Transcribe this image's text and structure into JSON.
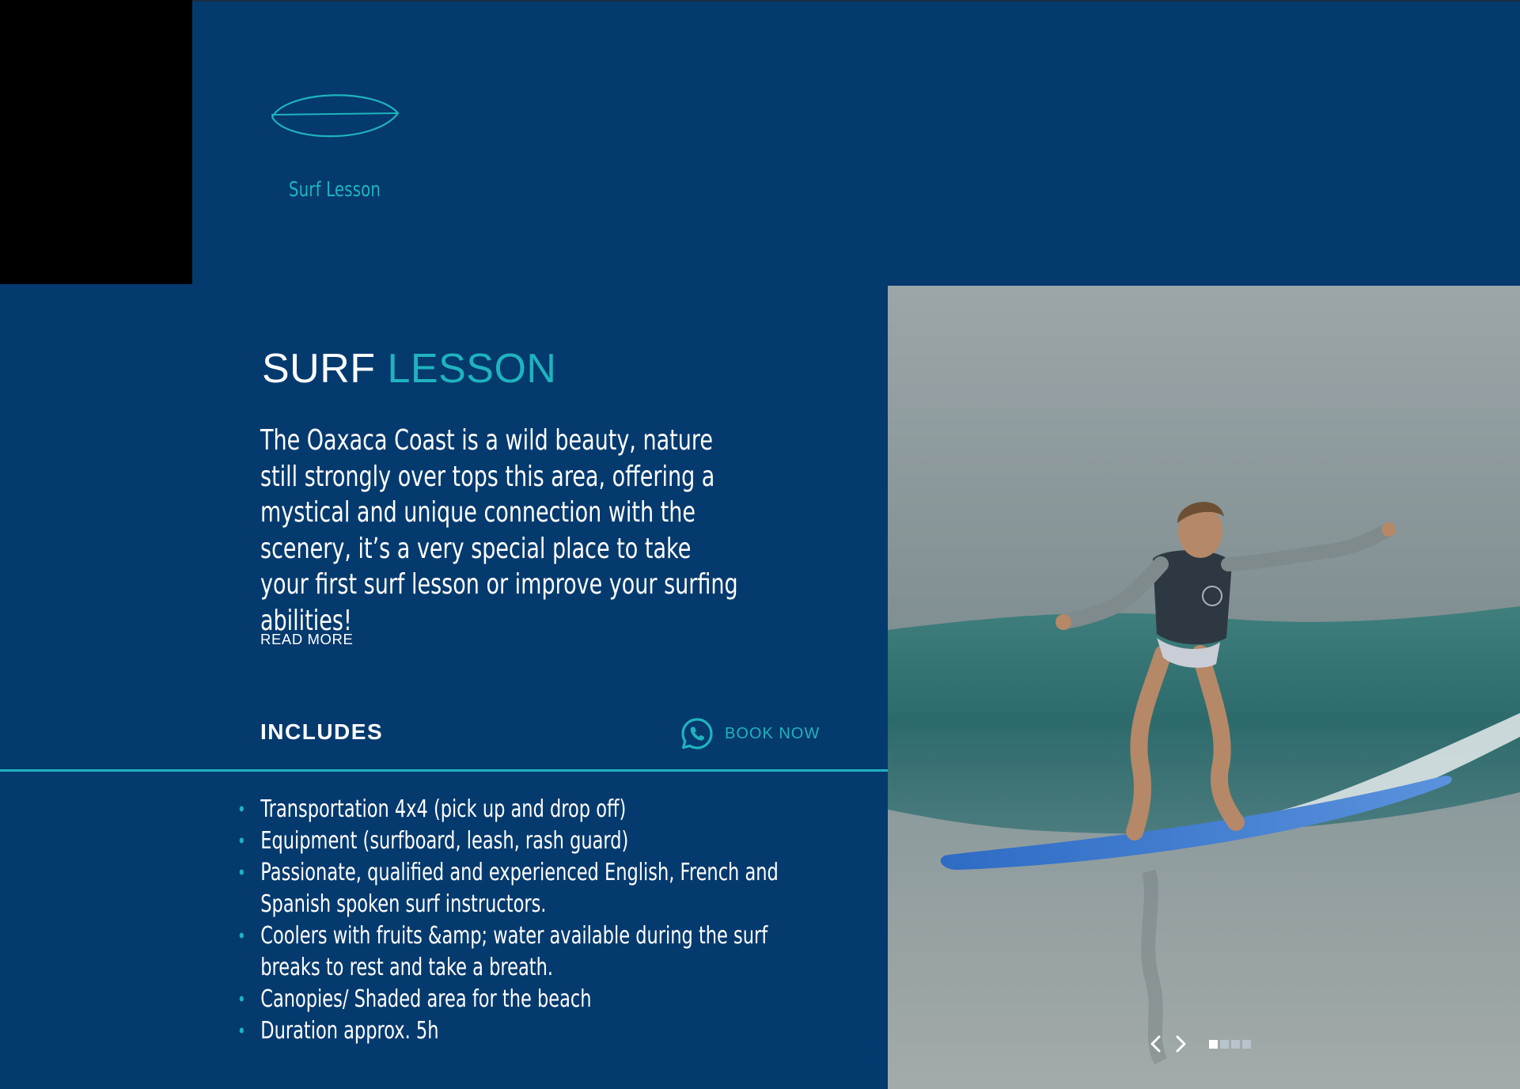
{
  "nav": {
    "surf_lesson_label": "Surf Lesson",
    "icon": "surfboard-icon"
  },
  "section": {
    "title_part1": "SURF",
    "title_part2": "LESSON",
    "description": "The Oaxaca Coast is a wild beauty, nature still strongly over tops this area, offering a mystical and unique connection with the scenery, it’s a very special place to take your first surf lesson or improve your surfing abilities!",
    "read_more": "READ MORE",
    "includes_title": "INCLUDES",
    "book_now": "BOOK NOW",
    "book_icon": "whatsapp-icon",
    "includes": [
      "Transportation 4x4 (pick up and drop off)",
      "Equipment (surfboard, leash, rash guard)",
      "Passionate, qualified and experienced English, French and Spanish spoken surf instructors.",
      "Coolers with fruits &amp; water available during the surf breaks to rest and take a breath.",
      "Canopies/ Shaded area for the beach",
      "Duration approx. 5h"
    ]
  },
  "slider": {
    "total_slides": 4,
    "active_index": 0
  },
  "colors": {
    "background": "#053a6e",
    "accent": "#1fb3bf",
    "text": "#ffffff"
  }
}
